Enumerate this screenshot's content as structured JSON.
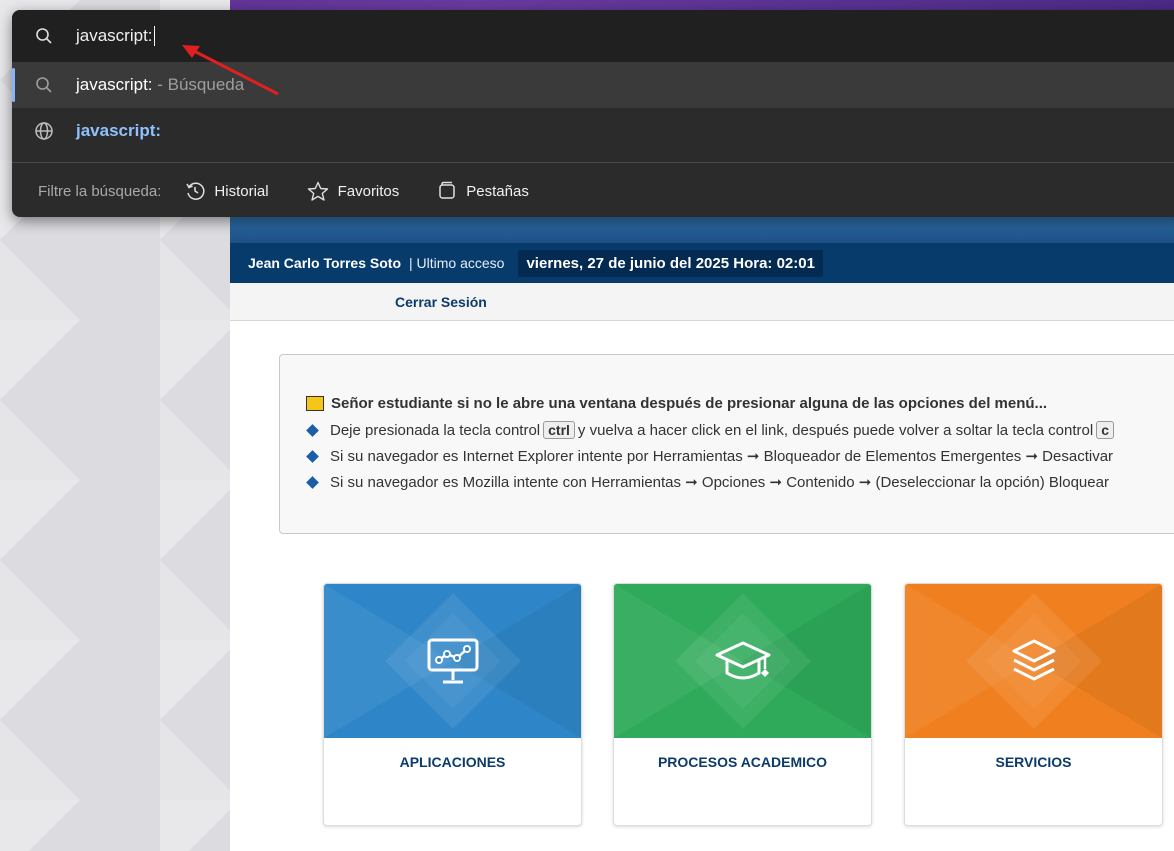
{
  "omnibox": {
    "input_value": "javascript:",
    "suggestions": [
      {
        "main": "javascript:",
        "suffix": " - Búsqueda",
        "icon": "search-icon"
      },
      {
        "main": "javascript:",
        "suffix": "",
        "icon": "globe-icon"
      }
    ],
    "filter_label": "Filtre la búsqueda:",
    "filters": [
      {
        "label": "Historial",
        "icon": "history-icon"
      },
      {
        "label": "Favoritos",
        "icon": "star-icon"
      },
      {
        "label": "Pestañas",
        "icon": "tabs-icon"
      }
    ]
  },
  "user_bar": {
    "name": "Jean Carlo Torres Soto",
    "last_access_label": "| Ultimo acceso",
    "date": "viernes, 27 de junio del 2025 Hora: 02:01"
  },
  "logout_label": "Cerrar Sesión",
  "notice": {
    "title": "Señor estudiante si no le abre una ventana después de presionar alguna de las opciones del menú...",
    "item1_a": "Deje presionada la tecla control",
    "item1_key": "ctrl",
    "item1_b": "y vuelva a hacer click en el link, después puede volver a soltar la tecla control",
    "item1_key2": "c",
    "item2": "Si su navegador es Internet Explorer intente por Herramientas ➞ Bloqueador de Elementos Emergentes ➞ Desactivar",
    "item3": "Si su navegador es Mozilla intente con Herramientas ➞ Opciones ➞ Contenido ➞ (Deseleccionar la opción) Bloquear"
  },
  "cards": [
    {
      "label": "APLICACIONES",
      "color": "#2e86c8",
      "icon": "monitor-chart-icon"
    },
    {
      "label": "PROCESOS ACADEMICO",
      "color": "#2eaa5a",
      "icon": "graduation-cap-icon"
    },
    {
      "label": "SERVICIOS",
      "color": "#f0801f",
      "icon": "layers-icon"
    }
  ],
  "colors": {
    "header_blue": "#063b6c",
    "accent_red_arrow": "#e02020"
  }
}
